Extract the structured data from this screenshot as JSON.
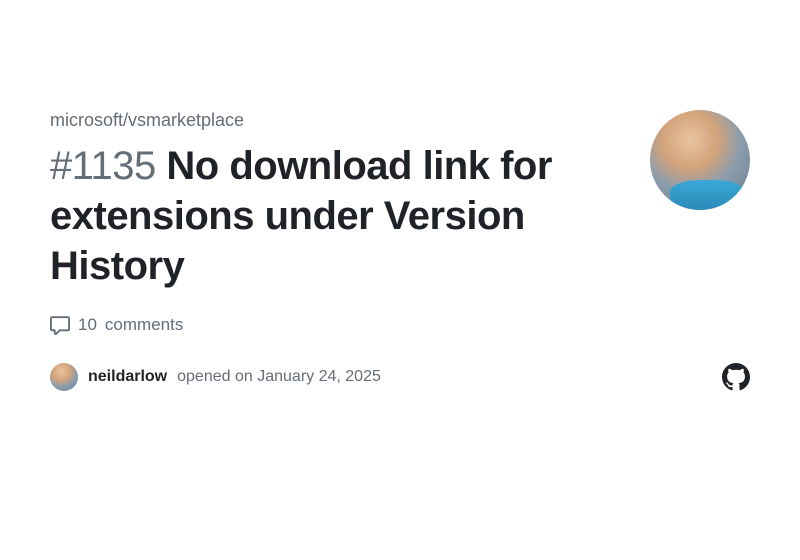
{
  "repo": {
    "path": "microsoft/vsmarketplace"
  },
  "issue": {
    "number": "#1135",
    "title": "No download link for extensions under Version History",
    "comments_count": "10",
    "comments_label": "comments"
  },
  "byline": {
    "username": "neildarlow",
    "opened_prefix": "opened on",
    "opened_date": "January 24, 2025"
  }
}
